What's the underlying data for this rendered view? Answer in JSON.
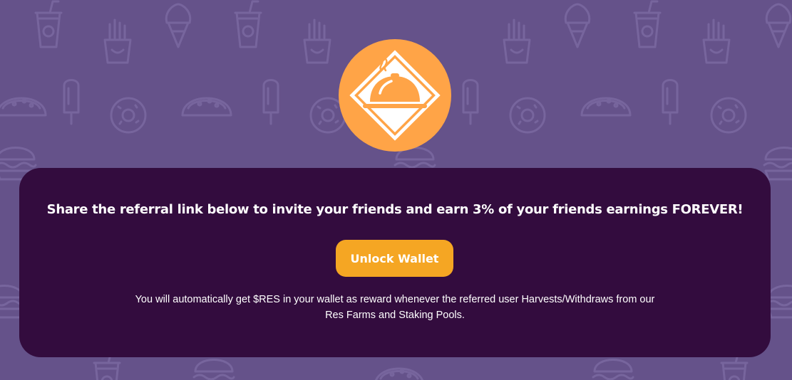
{
  "background": {
    "color": "#65528a",
    "pattern_icons": [
      "soda-cup-icon",
      "ice-cream-cone-icon",
      "french-fries-icon",
      "taco-icon",
      "popsicle-icon",
      "donut-icon",
      "burger-icon"
    ]
  },
  "logo": {
    "icon": "cloche-icon",
    "circle_color": "#ffa447"
  },
  "card": {
    "background": "#330c3e",
    "headline": "Share the referral link below to invite your friends and earn 3% of your friends earnings FOREVER!",
    "unlock_button_label": "Unlock Wallet",
    "unlock_button_color": "#f5a623",
    "note_line_1": "You will automatically get $RES in your wallet as reward whenever the referred user Harvests/Withdraws from our",
    "note_line_2": "Res Farms and Staking Pools."
  }
}
